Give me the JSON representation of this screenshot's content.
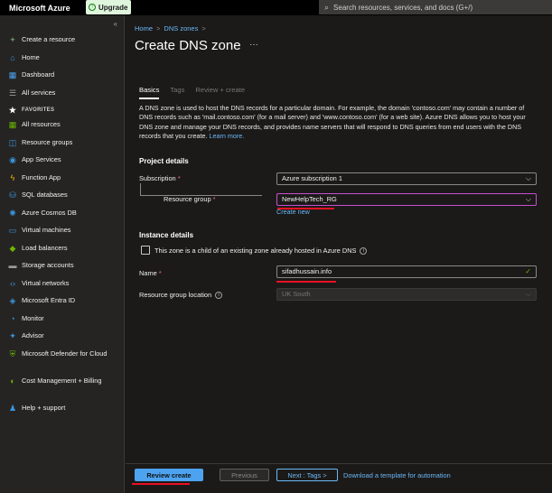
{
  "topbar": {
    "brand": "Microsoft Azure",
    "upgrade_label": "Upgrade",
    "search_placeholder": "Search resources, services, and docs (G+/)"
  },
  "sidebar": {
    "collapse_glyph": "«",
    "items": [
      {
        "label": "Create a resource",
        "icon": "plus-icon",
        "color": "#8fd694"
      },
      {
        "label": "Home",
        "icon": "home-icon",
        "color": "#3a96dd"
      },
      {
        "label": "Dashboard",
        "icon": "dashboard-icon",
        "color": "#4da3f0"
      },
      {
        "label": "All services",
        "icon": "list-icon",
        "color": "#9a9a9a"
      },
      {
        "label": "FAVORITES",
        "icon": "star-icon",
        "color": "#ffffff"
      },
      {
        "label": "All resources",
        "icon": "grid-icon",
        "color": "#6bb700"
      },
      {
        "label": "Resource groups",
        "icon": "resource-group-icon",
        "color": "#3a96dd"
      },
      {
        "label": "App Services",
        "icon": "app-services-icon",
        "color": "#3a96dd"
      },
      {
        "label": "Function App",
        "icon": "function-app-icon",
        "color": "#ffb900"
      },
      {
        "label": "SQL databases",
        "icon": "sql-database-icon",
        "color": "#3a96dd"
      },
      {
        "label": "Azure Cosmos DB",
        "icon": "cosmos-db-icon",
        "color": "#3a96dd"
      },
      {
        "label": "Virtual machines",
        "icon": "virtual-machine-icon",
        "color": "#3a96dd"
      },
      {
        "label": "Load balancers",
        "icon": "load-balancer-icon",
        "color": "#6bb700"
      },
      {
        "label": "Storage accounts",
        "icon": "storage-account-icon",
        "color": "#9a9a9a"
      },
      {
        "label": "Virtual networks",
        "icon": "virtual-network-icon",
        "color": "#3a96dd"
      },
      {
        "label": "Microsoft Entra ID",
        "icon": "entra-id-icon",
        "color": "#3a96dd"
      },
      {
        "label": "Monitor",
        "icon": "monitor-icon",
        "color": "#3a96dd"
      },
      {
        "label": "Advisor",
        "icon": "advisor-icon",
        "color": "#3a96dd"
      },
      {
        "label": "Microsoft Defender for Cloud",
        "icon": "defender-icon",
        "color": "#6bb700"
      },
      {
        "label": "Cost Management + Billing",
        "icon": "cost-management-icon",
        "color": "#6bb700"
      },
      {
        "label": "Help + support",
        "icon": "help-icon",
        "color": "#3a96dd"
      }
    ]
  },
  "breadcrumb": {
    "home": "Home",
    "dns": "DNS zones",
    "sep": ">"
  },
  "page": {
    "title": "Create DNS zone",
    "more": "···"
  },
  "tabs": {
    "basics": "Basics",
    "tags": "Tags",
    "review": "Review + create"
  },
  "description": {
    "text": "A DNS zone is used to host the DNS records for a particular domain. For example, the domain 'contoso.com' may contain a number of DNS records such as 'mail.contoso.com' (for a mail server) and 'www.contoso.com' (for a web site). Azure DNS allows you to host your DNS zone and manage your DNS records, and provides name servers that will respond to DNS queries from end users with the DNS records that you create.",
    "link": "Learn more."
  },
  "project": {
    "heading": "Project details",
    "subscription_label": "Subscription",
    "subscription_value": "Azure subscription 1",
    "rg_label": "Resource group",
    "rg_value": "NewHelpTech_RG",
    "create_new": "Create new"
  },
  "instance": {
    "heading": "Instance details",
    "child_zone_label": "This zone is a child of an existing zone already hosted in Azure DNS",
    "name_label": "Name",
    "name_value": "sifadhussain.info",
    "location_label": "Resource group location",
    "location_value": "UK South"
  },
  "footer": {
    "review_create": "Review create",
    "previous": "Previous",
    "next": "Next : Tags >",
    "download": "Download a template for automation"
  },
  "required_marker": "*",
  "info_glyph": "i"
}
